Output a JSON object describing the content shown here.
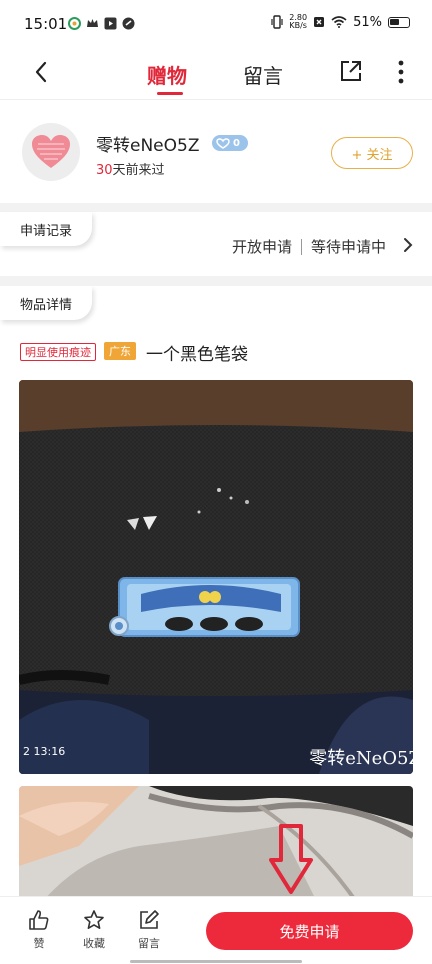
{
  "status_bar": {
    "time": "15:01",
    "net_speed_value": "2.80",
    "net_speed_unit": "KB/s",
    "battery": "51%"
  },
  "nav": {
    "tab_gift": "赠物",
    "tab_comment": "留言"
  },
  "profile": {
    "username": "零转eNeO5Z",
    "level": "0",
    "last_seen_days": "30",
    "last_seen_suffix": "天前来过",
    "follow_label": "+ 关注"
  },
  "application": {
    "section_label": "申请记录",
    "status_open": "开放申请",
    "status_waiting": "等待申请中"
  },
  "item": {
    "section_label": "物品详情",
    "condition_tag": "明显使用痕迹",
    "location_tag": "广东",
    "title": "一个黑色笔袋",
    "photo_timestamp": "2 13:16",
    "photo_watermark": "零转eNeO5Z"
  },
  "bottom_bar": {
    "like_label": "赞",
    "favorite_label": "收藏",
    "comment_label": "留言",
    "apply_button": "免费申请"
  },
  "colors": {
    "accent_red": "#e0283a",
    "follow_gold": "#e8b04a",
    "location_orange": "#f0a637"
  }
}
